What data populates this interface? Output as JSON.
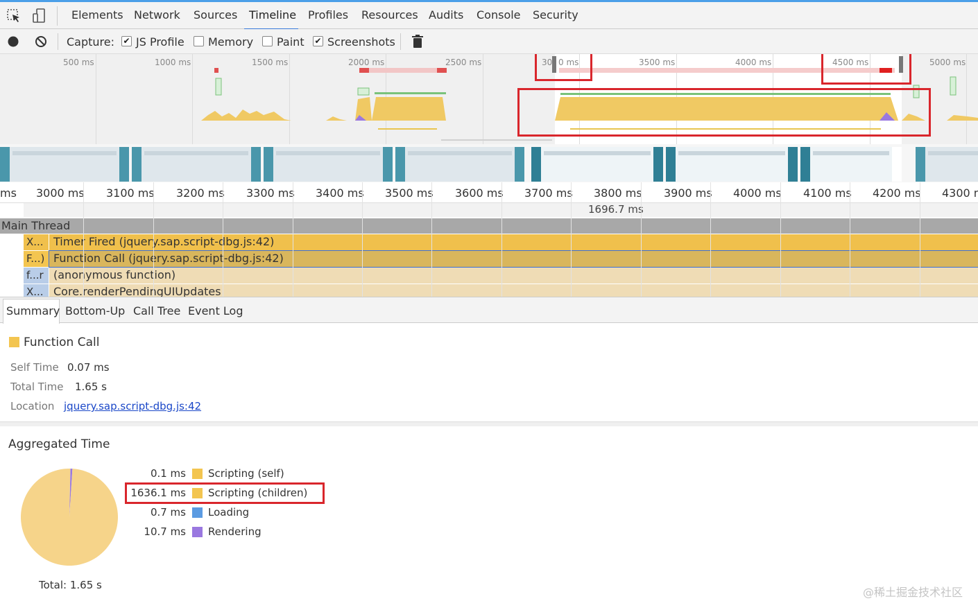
{
  "toolbar": {
    "tabs": [
      "Elements",
      "Network",
      "Sources",
      "Timeline",
      "Profiles",
      "Resources",
      "Audits",
      "Console",
      "Security"
    ],
    "active_tab": "Timeline"
  },
  "capture": {
    "label": "Capture:",
    "options": [
      {
        "label": "JS Profile",
        "checked": true
      },
      {
        "label": "Memory",
        "checked": false
      },
      {
        "label": "Paint",
        "checked": false
      },
      {
        "label": "Screenshots",
        "checked": true
      }
    ]
  },
  "overview": {
    "ticks": [
      "500 ms",
      "1000 ms",
      "1500 ms",
      "2000 ms",
      "2500 ms",
      "30",
      "0 ms",
      "3500 ms",
      "4000 ms",
      "4500 ms",
      "5000 ms"
    ]
  },
  "ruler": {
    "ticks": [
      "ms",
      "3000 ms",
      "3100 ms",
      "3200 ms",
      "3300 ms",
      "3400 ms",
      "3500 ms",
      "3600 ms",
      "3700 ms",
      "3800 ms",
      "3900 ms",
      "4000 ms",
      "4100 ms",
      "4200 ms",
      "4300 ms"
    ],
    "selection_duration": "1696.7 ms"
  },
  "flame": {
    "thread": "Main Thread",
    "rows": [
      {
        "short": "X...",
        "label": "Timer Fired (jquery.sap.script-dbg.js:42)",
        "color": "#f0c04c"
      },
      {
        "short": "F...)",
        "label": "Function Call (jquery.sap.script-dbg.js:42)",
        "color": "#d9b65c"
      },
      {
        "short": "f...r",
        "label": "(anonymous function)",
        "color": "#efdcb5"
      },
      {
        "short": "X...",
        "label": "Core.renderPendingUIUpdates",
        "color": "#efdcb5"
      }
    ]
  },
  "details": {
    "tabs": [
      "Summary",
      "Bottom-Up",
      "Call Tree",
      "Event Log"
    ],
    "active_tab": "Summary"
  },
  "summary": {
    "title": "Function Call",
    "color": "#f3c550",
    "self_time_label": "Self Time",
    "self_time": "0.07 ms",
    "total_time_label": "Total Time",
    "total_time": "1.65 s",
    "location_label": "Location",
    "location": "jquery.sap.script-dbg.js:42"
  },
  "aggregated": {
    "title": "Aggregated Time",
    "total": "Total: 1.65 s",
    "items": [
      {
        "value": "0.1 ms",
        "label": "Scripting (self)",
        "color": "#f3c550"
      },
      {
        "value": "1636.1 ms",
        "label": "Scripting (children)",
        "color": "#f3c550"
      },
      {
        "value": "0.7 ms",
        "label": "Loading",
        "color": "#5b9be2"
      },
      {
        "value": "10.7 ms",
        "label": "Rendering",
        "color": "#9a78e0"
      }
    ],
    "pie": [
      {
        "name": "Scripting",
        "value": 1636.2,
        "color": "#f6d48a"
      },
      {
        "name": "Loading",
        "value": 0.7,
        "color": "#5b9be2"
      },
      {
        "name": "Rendering",
        "value": 10.7,
        "color": "#9a78e0"
      }
    ]
  },
  "watermark": "@稀土掘金技术社区"
}
